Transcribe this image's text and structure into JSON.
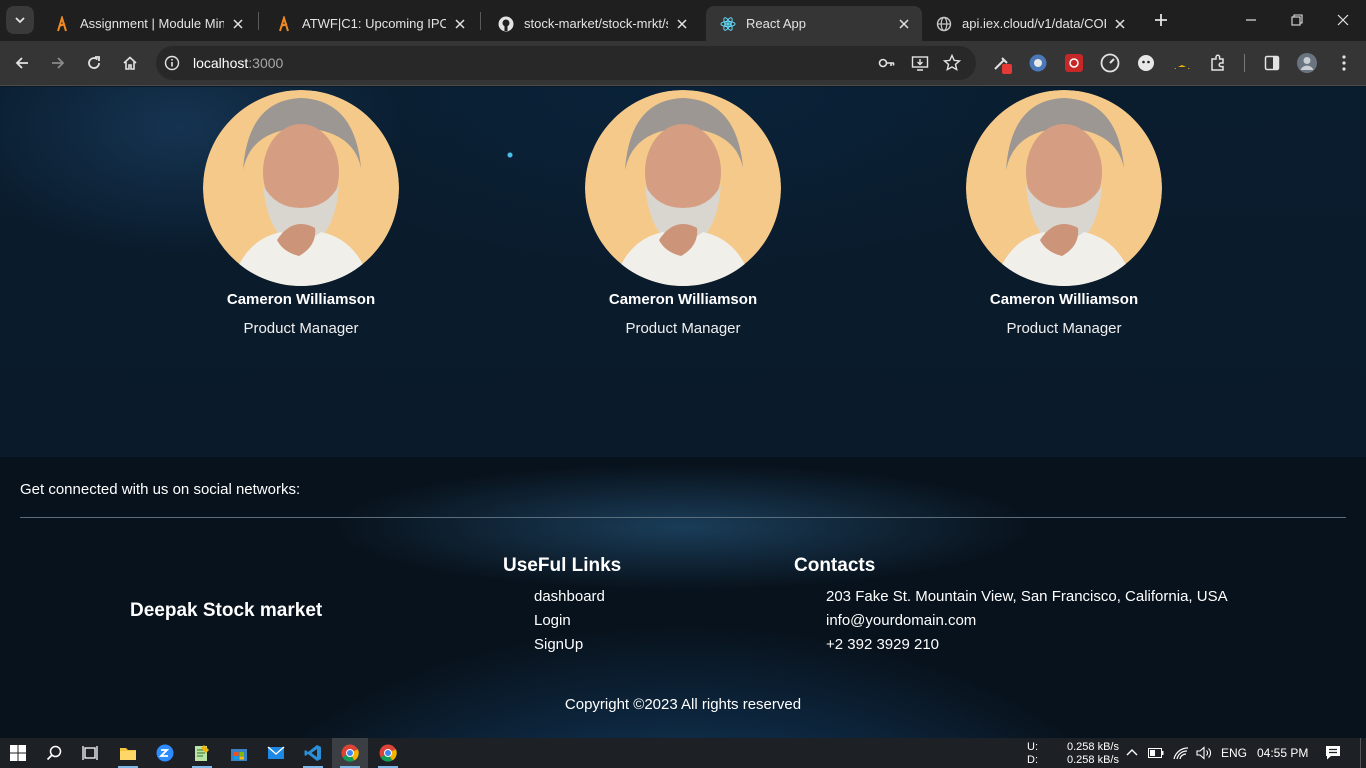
{
  "browser": {
    "tabs": [
      {
        "title": "Assignment | Module Mini Project",
        "icon": "coding-ninja-icon"
      },
      {
        "title": "ATWF|C1: Upcoming IPO and Stock Market",
        "icon": "coding-ninja-icon"
      },
      {
        "title": "stock-market/stock-mrkt/src",
        "icon": "github-icon"
      },
      {
        "title": "React App",
        "icon": "react-icon",
        "active": true
      },
      {
        "title": "api.iex.cloud/v1/data/CORE/",
        "icon": "globe-icon"
      }
    ],
    "address": {
      "host": "localhost",
      "port": ":3000"
    }
  },
  "team": {
    "members": [
      {
        "name": "Cameron Williamson",
        "role": "Product Manager"
      },
      {
        "name": "Cameron Williamson",
        "role": "Product Manager"
      },
      {
        "name": "Cameron Williamson",
        "role": "Product Manager"
      }
    ]
  },
  "footer": {
    "social_text": "Get connected with us on social networks:",
    "brand": "Deepak Stock market",
    "links_heading": "UseFul Links",
    "links": [
      "dashboard",
      "Login",
      "SignUp"
    ],
    "contacts_heading": "Contacts",
    "contacts": [
      "203 Fake St. Mountain View, San Francisco, California, USA",
      "info@yourdomain.com",
      "+2 392 3929 210"
    ],
    "copyright": "Copyright ©2023 All rights reserved"
  },
  "taskbar": {
    "net_up_label": "U:",
    "net_down_label": "D:",
    "net_up": "0.258 kB/s",
    "net_down": "0.258 kB/s",
    "language": "ENG",
    "time": "04:55 PM"
  },
  "colors": {
    "page_bg": "#0b1a28",
    "chrome_dark": "#1f1f1f",
    "chrome_toolbar": "#353535",
    "avatar_bg": "#f5c98a"
  }
}
